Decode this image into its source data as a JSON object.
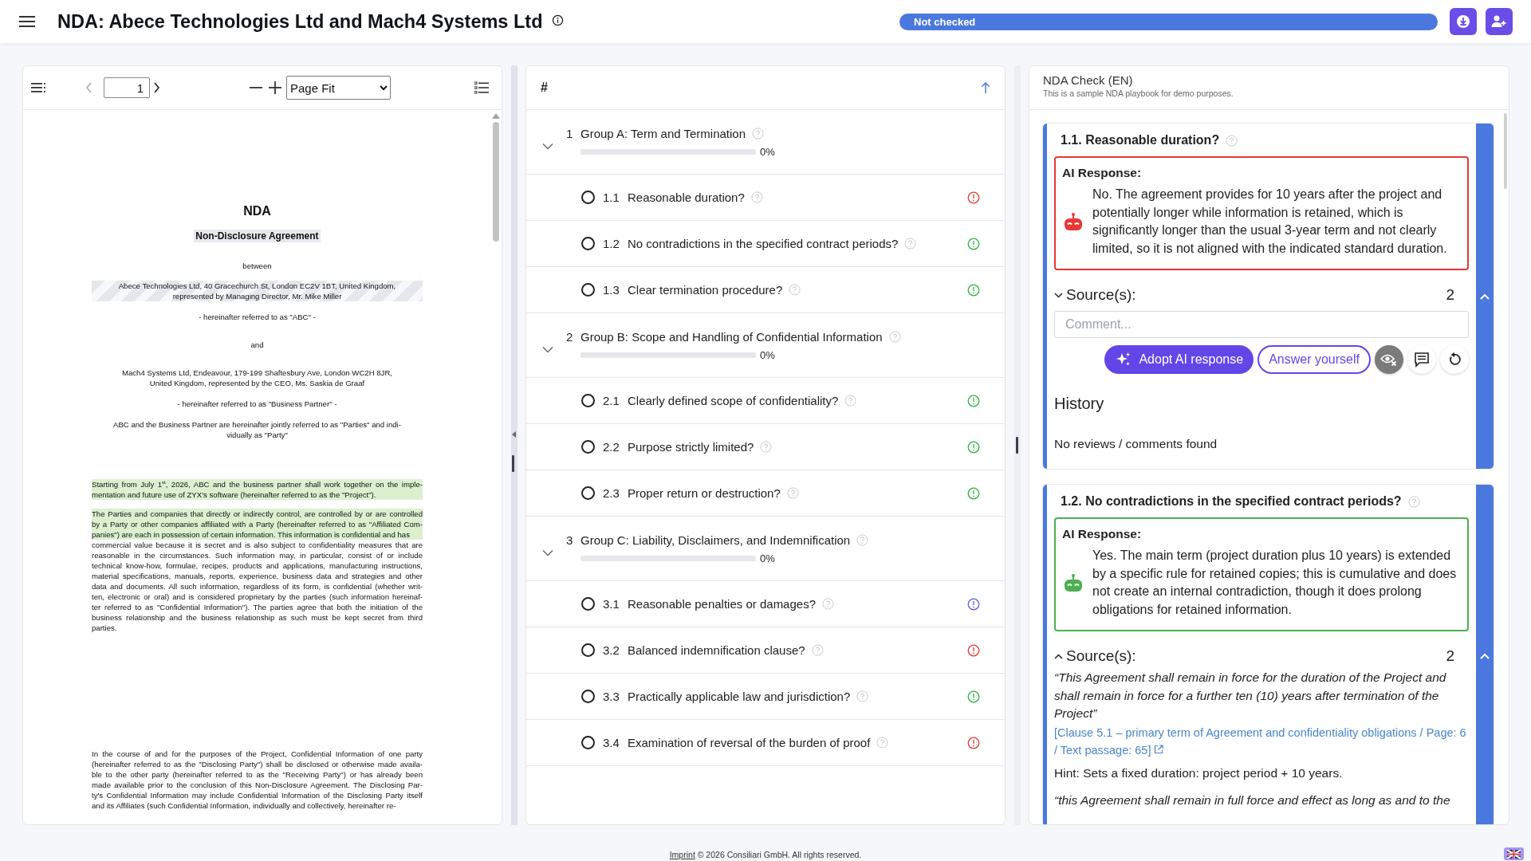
{
  "header": {
    "title": "NDA: Abece Technologies Ltd and Mach4 Systems Ltd",
    "status": "Not checked"
  },
  "document_viewer": {
    "page": "1",
    "zoom": "Page Fit",
    "sections": [
      {
        "blocks": [
          {
            "kind": "title",
            "highlighted": false,
            "lines": [
              "NDA"
            ]
          },
          {
            "kind": "subtitle",
            "highlighted": true,
            "lines": [
              "Non-Disclosure Agreement"
            ]
          },
          {
            "kind": "center",
            "highlighted": false,
            "lines": [
              "between"
            ]
          },
          {
            "kind": "party",
            "highlighted": true,
            "lines": [
              "Abece Technologies Ltd, 40 Gracechurch St, London EC2V 1BT, United Kingdom,",
              "represented by Managing Director, Mr. Mike Miller"
            ]
          },
          {
            "kind": "center",
            "highlighted": false,
            "lines": [
              "- hereinafter referred to as \"ABC\" -"
            ]
          },
          {
            "kind": "center",
            "highlighted": false,
            "lines": [
              "and"
            ]
          },
          {
            "kind": "party",
            "highlighted": false,
            "lines": [
              "Mach4 Systems Ltd, Endeavour, 179-199 Shaftesbury Ave, London WC2H 8JR,",
              "United Kingdom, represented by the CEO, Ms. Saskia de Graaf"
            ]
          },
          {
            "kind": "center",
            "highlighted": false,
            "lines": [
              "- hereinafter referred to as \"Business Partner\" -"
            ]
          },
          {
            "kind": "center",
            "highlighted": false,
            "lines": [
              "ABC and the Business Partner are hereinafter jointly referred to as \"Parties\" and indi-",
              "vidually as \"Party\""
            ]
          },
          {
            "kind": "justify",
            "highlighted": true,
            "lines": [
              "Starting from July 1$^{st}$, 2026, ABC and the business partner shall work together on the imple-",
              "mentation and future use of ZYX’s software (hereinafter referred to as the \"Project\")."
            ]
          },
          {
            "kind": "justify",
            "highlighted": true,
            "lines": [
              "The Parties and companies that directly or indirectly control, are controlled by or are controlled",
              "by a Party or other companies affiliated with a Party (hereinafter referred to as \"Affiliated Com-",
              "panies\") are each in possession of certain information. This information is confidential and has"
            ]
          },
          {
            "kind": "justify",
            "highlighted": false,
            "lines": [
              "commercial value because it is secret and is also subject to confidentiality measures that are",
              "reasonable in the circumstances. Such information may, in particular, consist of or include",
              "technical know-how, formulae, recipes, products and applications, manufacturing instructions,",
              "material specifications, manuals, reports, experience, business data and strategies and other",
              "data and documents. All such information, regardless of its form, is confidential (whether writ-",
              "ten, electronic or oral) and is considered proprietary by the parties (such information hereinaf-",
              "ter referred to as \"Confidential Information\"). The parties agree that both the initiation of the",
              "business relationship and the business relationship as such must be kept secret from third",
              "parties."
            ]
          }
        ]
      },
      {
        "blocks": [
          {
            "kind": "justify",
            "highlighted": false,
            "lines": [
              "In the course of and for the purposes of the Project, Confidential Information of one party",
              "(hereinafter referred to as the \"Disclosing Party\") shall be disclosed or otherwise made availa-",
              "ble to the other party (hereinafter referred to as the \"Receiving Party\") or has already been",
              "made available prior to the conclusion of this Non-Disclosure Agreement. The Disclosing Par-",
              "ty's Confidential Information may include Confidential Information of the Disclosing Party itself",
              "and its Affiliates (such Confidential Information, individually and collectively, hereinafter re-"
            ]
          }
        ]
      }
    ]
  },
  "checklist": {
    "header": "#",
    "groups": [
      {
        "number": "1",
        "title": "Group A: Term and Termination",
        "expanded": true,
        "level": 0,
        "percent": "0%",
        "items": [
          {
            "number": "1.1",
            "title": "Reasonable duration?",
            "checked": false,
            "color": "#e53935"
          },
          {
            "number": "1.2",
            "title": "No contradictions in the specified contract periods?",
            "checked": false,
            "color": "#2fb344"
          },
          {
            "number": "1.3",
            "title": "Clear termination procedure?",
            "checked": false,
            "color": "#2fb344"
          }
        ]
      },
      {
        "number": "2",
        "title": "Group B: Scope and Handling of Confidential Information",
        "expanded": true,
        "level": 0,
        "percent": "0%",
        "items": [
          {
            "number": "2.1",
            "title": "Clearly defined scope of confidentiality?",
            "checked": false,
            "color": "#2fb344"
          },
          {
            "number": "2.2",
            "title": "Purpose strictly limited?",
            "checked": false,
            "color": "#2fb344"
          },
          {
            "number": "2.3",
            "title": "Proper return or destruction?",
            "checked": false,
            "color": "#2fb344"
          }
        ]
      },
      {
        "number": "3",
        "title": "Group C: Liability, Disclaimers, and Indemnification",
        "expanded": true,
        "level": 0,
        "percent": "0%",
        "items": [
          {
            "number": "3.1",
            "title": "Reasonable penalties or damages?",
            "checked": false,
            "color": "#5b5fd6"
          },
          {
            "number": "3.2",
            "title": "Balanced indemnification clause?",
            "checked": false,
            "color": "#e53935"
          },
          {
            "number": "3.3",
            "title": "Practically applicable law and jurisdiction?",
            "checked": false,
            "color": "#2fb344"
          },
          {
            "number": "3.4",
            "title": "Examination of reversal of the burden of proof",
            "checked": false,
            "color": "#e53935"
          }
        ]
      }
    ]
  },
  "review": {
    "title": "NDA Check (EN)",
    "subtitle": "This is a sample NDA playbook for demo purposes.",
    "cards": [
      {
        "title": "1.1. Reasonable duration?",
        "kind": "negative",
        "response_label": "AI Response:",
        "response": "No. The agreement provides for 10 years after the project and potentially longer while information is retained, which is significantly longer than the usual 3-year term and not clearly limited, so it is not aligned with the indicated standard duration.",
        "sources": {
          "label": "Source(s):",
          "count": "2",
          "expanded": false
        },
        "comment_placeholder": "Comment...",
        "actions": [
          "Adopt AI response",
          "Answer yourself"
        ],
        "history": {
          "title": "History",
          "empty": "No reviews / comments found"
        }
      },
      {
        "title": "1.2. No contradictions in the specified contract periods?",
        "kind": "positive",
        "response_label": "AI Response:",
        "response": "Yes. The main term (project duration plus 10 years) is extended by a specific rule for retained copies; this is cumulative and does not create an internal contradiction, though it does prolong obligations for retained information.",
        "sources": {
          "label": "Source(s):",
          "count": "2",
          "expanded": true,
          "items": [
            {
              "quote": "“This Agreement shall remain in force for the duration of the Project and shall remain in force for a further ten (10) years after termination of the Project”",
              "reference": "[Clause 5.1 – primary term of Agreement and confidentiality obligations / Page: 6 / Text passage: 65]",
              "hint": "Hint: Sets a fixed duration: project period + 10 years."
            },
            {
              "quote": "“this Agreement shall remain in full force and effect as long as and to the"
            }
          ]
        }
      }
    ]
  },
  "footer": {
    "link": "Imprint",
    "text": "© 2026 Consiliari GmbH. All rights reserved."
  }
}
